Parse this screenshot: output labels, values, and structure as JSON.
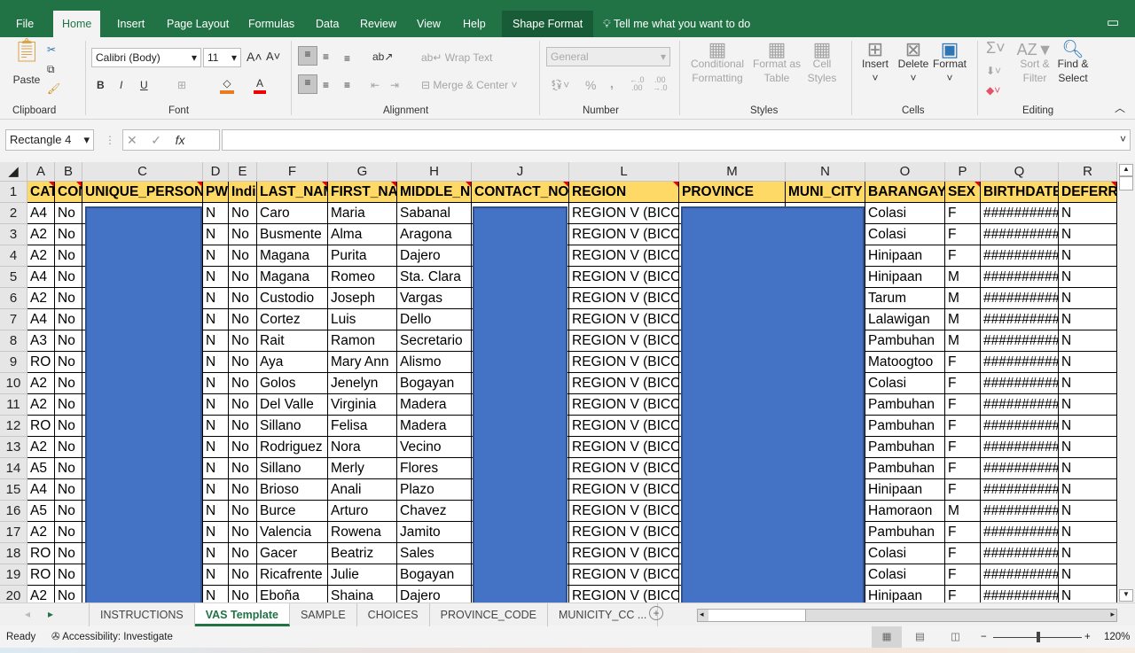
{
  "tabs": [
    "File",
    "Home",
    "Insert",
    "Page Layout",
    "Formulas",
    "Data",
    "Review",
    "View",
    "Help",
    "Shape Format"
  ],
  "tell_me": "Tell me what you want to do",
  "ribbon": {
    "clipboard": {
      "paste": "Paste",
      "label": "Clipboard"
    },
    "font": {
      "name": "Calibri (Body)",
      "size": "11",
      "bold": "B",
      "italic": "I",
      "underline": "U",
      "label": "Font"
    },
    "alignment": {
      "wrap": "Wrap Text",
      "merge": "Merge & Center",
      "label": "Alignment"
    },
    "number": {
      "format": "General",
      "percent": "%",
      "comma": ",",
      "label": "Number"
    },
    "styles": {
      "conditional": "Conditional Formatting",
      "format_table": "Format as Table",
      "cell_styles": "Cell Styles",
      "label": "Styles"
    },
    "cells": {
      "insert": "Insert",
      "delete": "Delete",
      "format": "Format",
      "label": "Cells"
    },
    "editing": {
      "sort": "Sort & Filter",
      "find": "Find & Select",
      "label": "Editing"
    }
  },
  "name_box": "Rectangle 4",
  "formula": "",
  "columns": [
    "A",
    "B",
    "C",
    "D",
    "E",
    "F",
    "G",
    "H",
    "J",
    "L",
    "M",
    "N",
    "O",
    "P",
    "Q",
    "R"
  ],
  "headers": [
    "CAT",
    "CON",
    "UNIQUE_PERSON",
    "PW",
    "Indi",
    "LAST_NAM",
    "FIRST_NA",
    "MIDDLE_N",
    "CONTACT_NO",
    "REGION",
    "PROVINCE",
    "MUNI_CITY",
    "BARANGAY",
    "SEX",
    "BIRTHDATE",
    "DEFERRA"
  ],
  "rows": [
    [
      "2",
      "A4",
      "No",
      "",
      "N",
      "No",
      "Caro",
      "Maria",
      "Sabanal",
      "",
      "REGION V (BICO",
      "",
      "",
      "Colasi",
      "F",
      "##########",
      "N"
    ],
    [
      "3",
      "A2",
      "No",
      "",
      "N",
      "No",
      "Busmente",
      "Alma",
      "Aragona",
      "",
      "REGION V (BICO",
      "",
      "",
      "Colasi",
      "F",
      "##########",
      "N"
    ],
    [
      "4",
      "A2",
      "No",
      "",
      "N",
      "No",
      "Magana",
      "Purita",
      "Dajero",
      "",
      "REGION V (BICO",
      "",
      "",
      "Hinipaan",
      "F",
      "##########",
      "N"
    ],
    [
      "5",
      "A4",
      "No",
      "",
      "N",
      "No",
      "Magana",
      "Romeo",
      "Sta. Clara",
      "",
      "REGION V (BICO",
      "",
      "",
      "Hinipaan",
      "M",
      "##########",
      "N"
    ],
    [
      "6",
      "A2",
      "No",
      "",
      "N",
      "No",
      "Custodio",
      "Joseph",
      "Vargas",
      "",
      "REGION V (BICO",
      "",
      "",
      "Tarum",
      "M",
      "##########",
      "N"
    ],
    [
      "7",
      "A4",
      "No",
      "",
      "N",
      "No",
      "Cortez",
      "Luis",
      "Dello",
      "",
      "REGION V (BICO",
      "",
      "",
      "Lalawigan",
      "M",
      "##########",
      "N"
    ],
    [
      "8",
      "A3",
      "No",
      "",
      "N",
      "No",
      "Rait",
      "Ramon",
      "Secretario",
      "",
      "REGION V (BICO",
      "",
      "",
      "Pambuhan",
      "M",
      "##########",
      "N"
    ],
    [
      "9",
      "RO",
      "No",
      "",
      "N",
      "No",
      "Aya",
      "Mary Ann",
      "Alismo",
      "",
      "REGION V (BICO",
      "",
      "",
      "Matoogtoo",
      "F",
      "##########",
      "N"
    ],
    [
      "10",
      "A2",
      "No",
      "",
      "N",
      "No",
      "Golos",
      "Jenelyn",
      "Bogayan",
      "",
      "REGION V (BICO",
      "",
      "",
      "Colasi",
      "F",
      "##########",
      "N"
    ],
    [
      "11",
      "A2",
      "No",
      "",
      "N",
      "No",
      "Del Valle",
      "Virginia",
      "Madera",
      "",
      "REGION V (BICO",
      "",
      "",
      "Pambuhan",
      "F",
      "##########",
      "N"
    ],
    [
      "12",
      "RO",
      "No",
      "",
      "N",
      "No",
      "Sillano",
      "Felisa",
      "Madera",
      "",
      "REGION V (BICO",
      "",
      "",
      "Pambuhan",
      "F",
      "##########",
      "N"
    ],
    [
      "13",
      "A2",
      "No",
      "",
      "N",
      "No",
      "Rodriguez",
      "Nora",
      "Vecino",
      "",
      "REGION V (BICO",
      "",
      "",
      "Pambuhan",
      "F",
      "##########",
      "N"
    ],
    [
      "14",
      "A5",
      "No",
      "",
      "N",
      "No",
      "Sillano",
      "Merly",
      "Flores",
      "",
      "REGION V (BICO",
      "",
      "",
      "Pambuhan",
      "F",
      "##########",
      "N"
    ],
    [
      "15",
      "A4",
      "No",
      "",
      "N",
      "No",
      "Brioso",
      "Anali",
      "Plazo",
      "",
      "REGION V (BICO",
      "",
      "",
      "Hinipaan",
      "F",
      "##########",
      "N"
    ],
    [
      "16",
      "A5",
      "No",
      "",
      "N",
      "No",
      "Burce",
      "Arturo",
      "Chavez",
      "",
      "REGION V (BICO",
      "",
      "",
      "Hamoraon",
      "M",
      "##########",
      "N"
    ],
    [
      "17",
      "A2",
      "No",
      "",
      "N",
      "No",
      "Valencia",
      "Rowena",
      "Jamito",
      "",
      "REGION V (BICO",
      "",
      "",
      "Pambuhan",
      "F",
      "##########",
      "N"
    ],
    [
      "18",
      "RO",
      "No",
      "",
      "N",
      "No",
      "Gacer",
      "Beatriz",
      "Sales",
      "",
      "REGION V (BICO",
      "",
      "",
      "Colasi",
      "F",
      "##########",
      "N"
    ],
    [
      "19",
      "RO",
      "No",
      "",
      "N",
      "No",
      "Ricafrente",
      "Julie",
      "Bogayan",
      "",
      "REGION V (BICO",
      "",
      "",
      "Colasi",
      "F",
      "##########",
      "N"
    ],
    [
      "20",
      "A2",
      "No",
      "",
      "N",
      "No",
      "Eboña",
      "Shaina",
      "Dajero",
      "",
      "REGION V (BICO",
      "",
      "",
      "Hinipaan",
      "F",
      "##########",
      "N"
    ]
  ],
  "sheet_tabs": [
    "INSTRUCTIONS",
    "VAS Template",
    "SAMPLE",
    "CHOICES",
    "PROVINCE_CODE",
    "MUNICITY_CC ..."
  ],
  "active_sheet": "VAS Template",
  "status": {
    "ready": "Ready",
    "accessibility": "Accessibility: Investigate",
    "zoom": "120%"
  },
  "zoom_level_percent": 120,
  "colors": {
    "excel_green": "#217346",
    "header_fill": "#ffd966",
    "shape_fill": "#4472c4",
    "comment_marker": "#ee0000"
  }
}
